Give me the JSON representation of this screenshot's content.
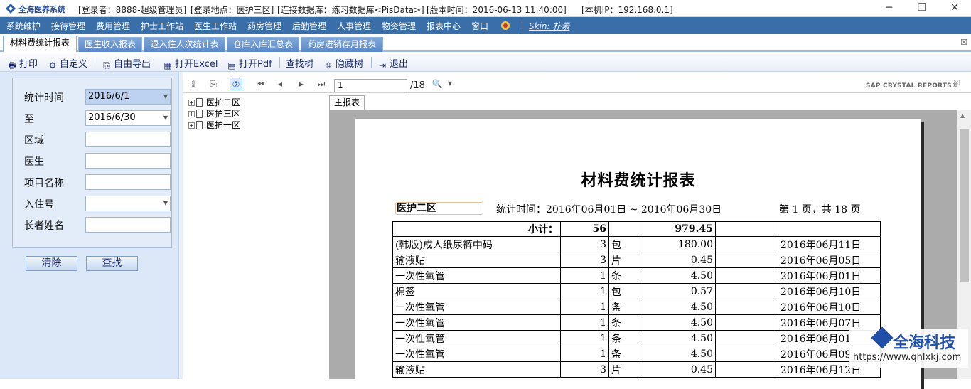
{
  "titlebar": {
    "app_name": "全海医养系统",
    "login_user": "[登录者：8888-超级管理员]",
    "login_place": "[登录地点：医护三区]",
    "database": "[连接数据库：练习数据库<PisData>]",
    "version": "[版本时间：2016-06-13 11:40:00]",
    "local_ip": "[本机IP：192.168.0.1]",
    "minimize": "─",
    "restore": "❐",
    "close": "✕"
  },
  "menu": {
    "items": [
      "系统维护",
      "接待管理",
      "费用管理",
      "护士工作站",
      "医生工作站",
      "药房管理",
      "后勤管理",
      "人事管理",
      "物资管理",
      "报表中心",
      "窗口"
    ],
    "skin_label": "Skin: 朴素"
  },
  "tabs": {
    "items": [
      "材料费统计报表",
      "医生收入报表",
      "退入住人次统计表",
      "仓库入库汇总表",
      "药房进销存月报表"
    ],
    "active_index": 0,
    "close_glyph": "☒"
  },
  "toolbar": {
    "print": "打印",
    "custom": "自定义",
    "free_export": "自由导出",
    "open_excel": "打开Excel",
    "open_pdf": "打开Pdf",
    "find_tree": "查找树",
    "hide_tree": "隐藏树",
    "exit": "退出"
  },
  "filter": {
    "stat_time_label": "统计时间",
    "stat_time_value": "2016/6/1",
    "to_label": "至",
    "to_value": "2016/6/30",
    "area_label": "区域",
    "area_value": "",
    "doctor_label": "医生",
    "doctor_value": "",
    "item_label": "项目名称",
    "item_value": "",
    "admit_label": "入住号",
    "admit_value": "",
    "elder_label": "长者姓名",
    "elder_value": "",
    "clear_button": "清除",
    "search_button": "查找"
  },
  "viewer": {
    "page_value": "1",
    "page_total": "/18",
    "brand": "SAP CRYSTAL REPORTS®",
    "main_tab": "主报表",
    "tree": [
      "医护二区",
      "医护三区",
      "医护一区"
    ]
  },
  "report": {
    "title": "材料费统计报表",
    "area": "医护二区",
    "period": "统计时间：2016年06月01日 ~ 2016年06月30日",
    "page_info": "第 1 页，共 18 页",
    "subtotal": {
      "label": "小计：",
      "qty": "56",
      "amount": "979.45"
    },
    "rows": [
      {
        "name": "(韩版)成人纸尿裤中码",
        "qty": "3",
        "unit": "包",
        "amount": "180.00",
        "date": "2016年06月11日"
      },
      {
        "name": "输液贴",
        "qty": "3",
        "unit": "片",
        "amount": "0.45",
        "date": "2016年06月05日"
      },
      {
        "name": "一次性氧管",
        "qty": "1",
        "unit": "条",
        "amount": "4.50",
        "date": "2016年06月01日"
      },
      {
        "name": "棉签",
        "qty": "1",
        "unit": "包",
        "amount": "0.57",
        "date": "2016年06月10日"
      },
      {
        "name": "一次性氧管",
        "qty": "1",
        "unit": "条",
        "amount": "4.50",
        "date": "2016年06月10日"
      },
      {
        "name": "一次性氧管",
        "qty": "1",
        "unit": "条",
        "amount": "4.50",
        "date": "2016年06月07日"
      },
      {
        "name": "一次性氧管",
        "qty": "1",
        "unit": "条",
        "amount": "4.50",
        "date": "2016年06月01"
      },
      {
        "name": "一次性氧管",
        "qty": "1",
        "unit": "条",
        "amount": "4.50",
        "date": "2016年06月09"
      },
      {
        "name": "输液贴",
        "qty": "3",
        "unit": "片",
        "amount": "0.45",
        "date": "2016年06月12日"
      }
    ]
  },
  "watermark": {
    "brand": "全海科技",
    "url": "https://www.qhlxkj.com"
  }
}
